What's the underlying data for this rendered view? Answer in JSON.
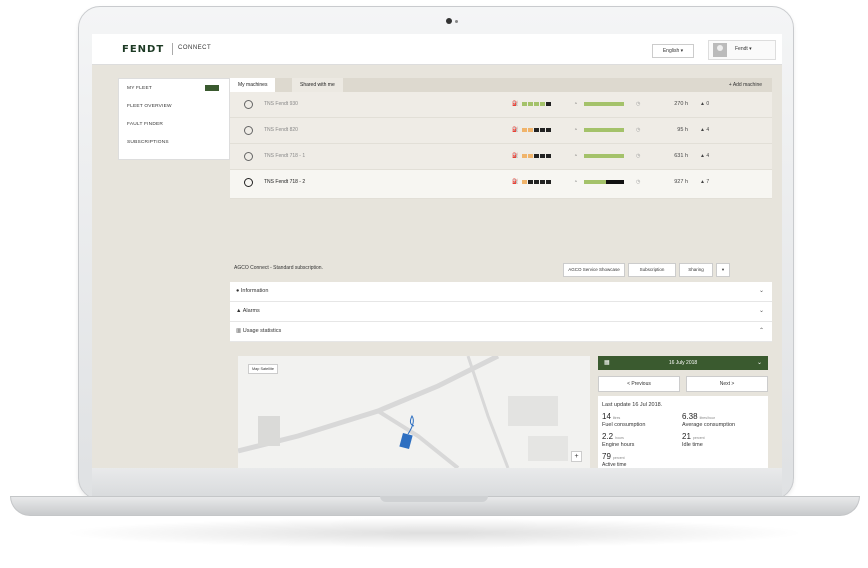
{
  "app": {
    "brand": "FENDT",
    "product": "CONNECT",
    "language": "English",
    "user": "Fendt"
  },
  "sidebar": {
    "items": [
      {
        "label": "MY FLEET"
      },
      {
        "label": "FLEET OVERVIEW"
      },
      {
        "label": "FAULT FINDER"
      },
      {
        "label": "SUBSCRIPTIONS"
      }
    ]
  },
  "tabs": [
    {
      "label": "My machines"
    },
    {
      "label": "Shared with me"
    }
  ],
  "add_machine": "+ Add machine",
  "machines": [
    {
      "name": "TNS Fendt 930",
      "hours": "270 h",
      "alarms": "0"
    },
    {
      "name": "TNS Fendt 820",
      "hours": "95 h",
      "alarms": "4"
    },
    {
      "name": "TNS Fendt 718 - 1",
      "hours": "631 h",
      "alarms": "4"
    },
    {
      "name": "TNS Fendt 718 - 2",
      "hours": "927 h",
      "alarms": "7"
    }
  ],
  "subscription": {
    "text": "AGCO Connect - Standard subscription.",
    "buttons": [
      "AGCO Service Showcase",
      "Subscription",
      "Sharing"
    ]
  },
  "accordion": [
    {
      "label": "Information"
    },
    {
      "label": "Alarms"
    },
    {
      "label": "Usage statistics"
    }
  ],
  "map": {
    "tabs": "Map   Satellite"
  },
  "panel": {
    "date": "16 July 2018",
    "previous": "< Previous",
    "next": "Next >",
    "last_update": "Last update 16 Jul 2018.",
    "stats": [
      {
        "value": "14",
        "unit": "litres",
        "label": "Fuel consumption"
      },
      {
        "value": "6.38",
        "unit": "litres/hour",
        "label": "Average consumption"
      },
      {
        "value": "2.2",
        "unit": "hours",
        "label": "Engine hours"
      },
      {
        "value": "21",
        "unit": "percent",
        "label": "Idle time"
      },
      {
        "value": "79",
        "unit": "percent",
        "label": "Active time"
      }
    ]
  },
  "colors": {
    "brand_green": "#3a5a2f",
    "bar_green": "#a4c26a",
    "bar_orange": "#f0b46b",
    "bar_dark": "#222222"
  }
}
